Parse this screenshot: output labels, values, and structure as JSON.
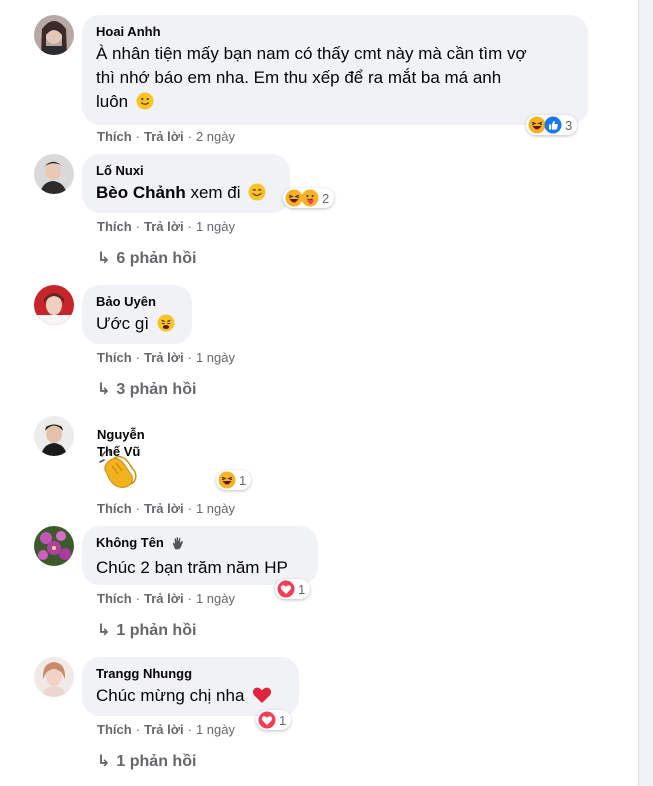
{
  "comments": [
    {
      "author": "Hoai Anhh",
      "text": "À nhân tiện mấy bạn nam có thấy cmt này mà cần tìm vợ thì nhớ báo em nha. Em thu xếp để ra mắt ba má anh luôn",
      "text_line1": "À nhân tiện mấy bạn nam có thấy cmt này mà cần tìm vợ",
      "text_line2": "thì nhớ báo em nha. Em thu xếp để ra mắt ba má anh",
      "text_line3": "luôn",
      "inline_emoji": "slightly-smiling-face",
      "like": "Thích",
      "reply": "Trả lời",
      "time": "2 ngày",
      "reactions": [
        "haha",
        "like"
      ],
      "reaction_count": "3"
    },
    {
      "author": "Lố Nuxi",
      "mention": "Bèo Chảnh",
      "text": "xem đi",
      "inline_emoji": "smiling-face",
      "like": "Thích",
      "reply": "Trả lời",
      "time": "1 ngày",
      "reactions": [
        "haha",
        "care"
      ],
      "reaction_count": "2",
      "replies": "6 phản hồi"
    },
    {
      "author": "Bảo Uyên",
      "text": "Ước gì",
      "inline_emoji": "weary-face",
      "like": "Thích",
      "reply": "Trả lời",
      "time": "1 ngày",
      "replies": "3 phản hồi"
    },
    {
      "author": "Nguyễn Thế Vũ",
      "sticker": "clapping-hands",
      "like": "Thích",
      "reply": "Trả lời",
      "time": "1 ngày",
      "reactions": [
        "haha"
      ],
      "reaction_count": "1"
    },
    {
      "author": "Không Tên",
      "author_emoji": "waving-hand",
      "text": "Chúc 2 bạn trăm năm HP",
      "like": "Thích",
      "reply": "Trả lời",
      "time": "1 ngày",
      "reactions": [
        "love"
      ],
      "reaction_count": "1",
      "replies": "1 phản hồi"
    },
    {
      "author": "Trangg Nhungg",
      "text": "Chúc mừng chị nha",
      "inline_emoji": "red-heart",
      "like": "Thích",
      "reply": "Trả lời",
      "time": "1 ngày",
      "reactions": [
        "love"
      ],
      "reaction_count": "1",
      "replies": "1 phản hồi"
    }
  ],
  "separator": "·",
  "colors": {
    "bubble": "#f0f2f5",
    "meta": "#65676b",
    "text": "#050505",
    "like_blue": "#1877f2",
    "love_red": "#f33e58",
    "haha_yellow": "#f7b125"
  }
}
